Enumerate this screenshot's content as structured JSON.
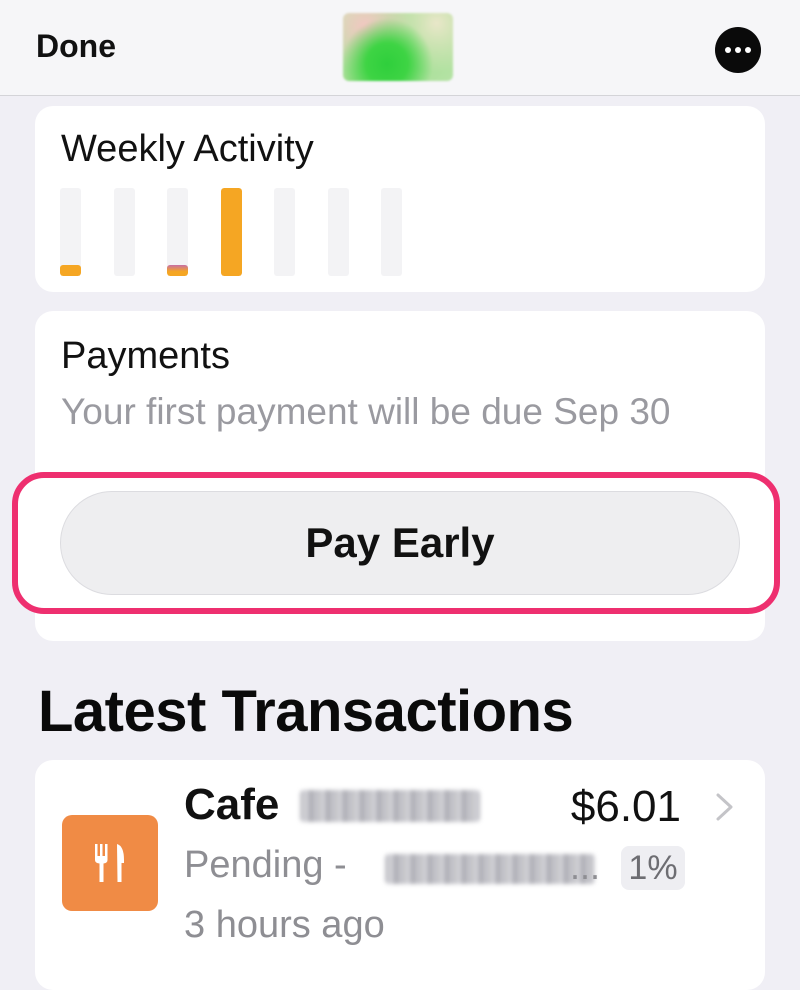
{
  "navbar": {
    "done_label": "Done"
  },
  "weekly_activity": {
    "title": "Weekly Activity",
    "bars": [
      {
        "level": 0.12,
        "color": "#f5a623",
        "accent": null
      },
      {
        "level": 0,
        "color": null,
        "accent": null
      },
      {
        "level": 0.1,
        "color": "#f5a623",
        "accent": "#c86fa4"
      },
      {
        "level": 1.0,
        "color": "#f5a623",
        "accent": null
      },
      {
        "level": 0,
        "color": null,
        "accent": null
      },
      {
        "level": 0,
        "color": null,
        "accent": null
      },
      {
        "level": 0,
        "color": null,
        "accent": null
      }
    ]
  },
  "payments": {
    "title": "Payments",
    "subtitle": "Your first payment will be due Sep 30",
    "pay_early_label": "Pay Early"
  },
  "transactions": {
    "section_title": "Latest Transactions",
    "items": [
      {
        "name": "Cafe",
        "amount": "$6.01",
        "status": "Pending -",
        "ellipsis": "...",
        "cashback": "1%",
        "time": "3 hours ago",
        "icon": "fork-knife-icon",
        "icon_color": "#f08b45"
      }
    ]
  },
  "colors": {
    "accent": "#f5a623",
    "highlight": "#ee2f6f",
    "background": "#f0eff5"
  }
}
